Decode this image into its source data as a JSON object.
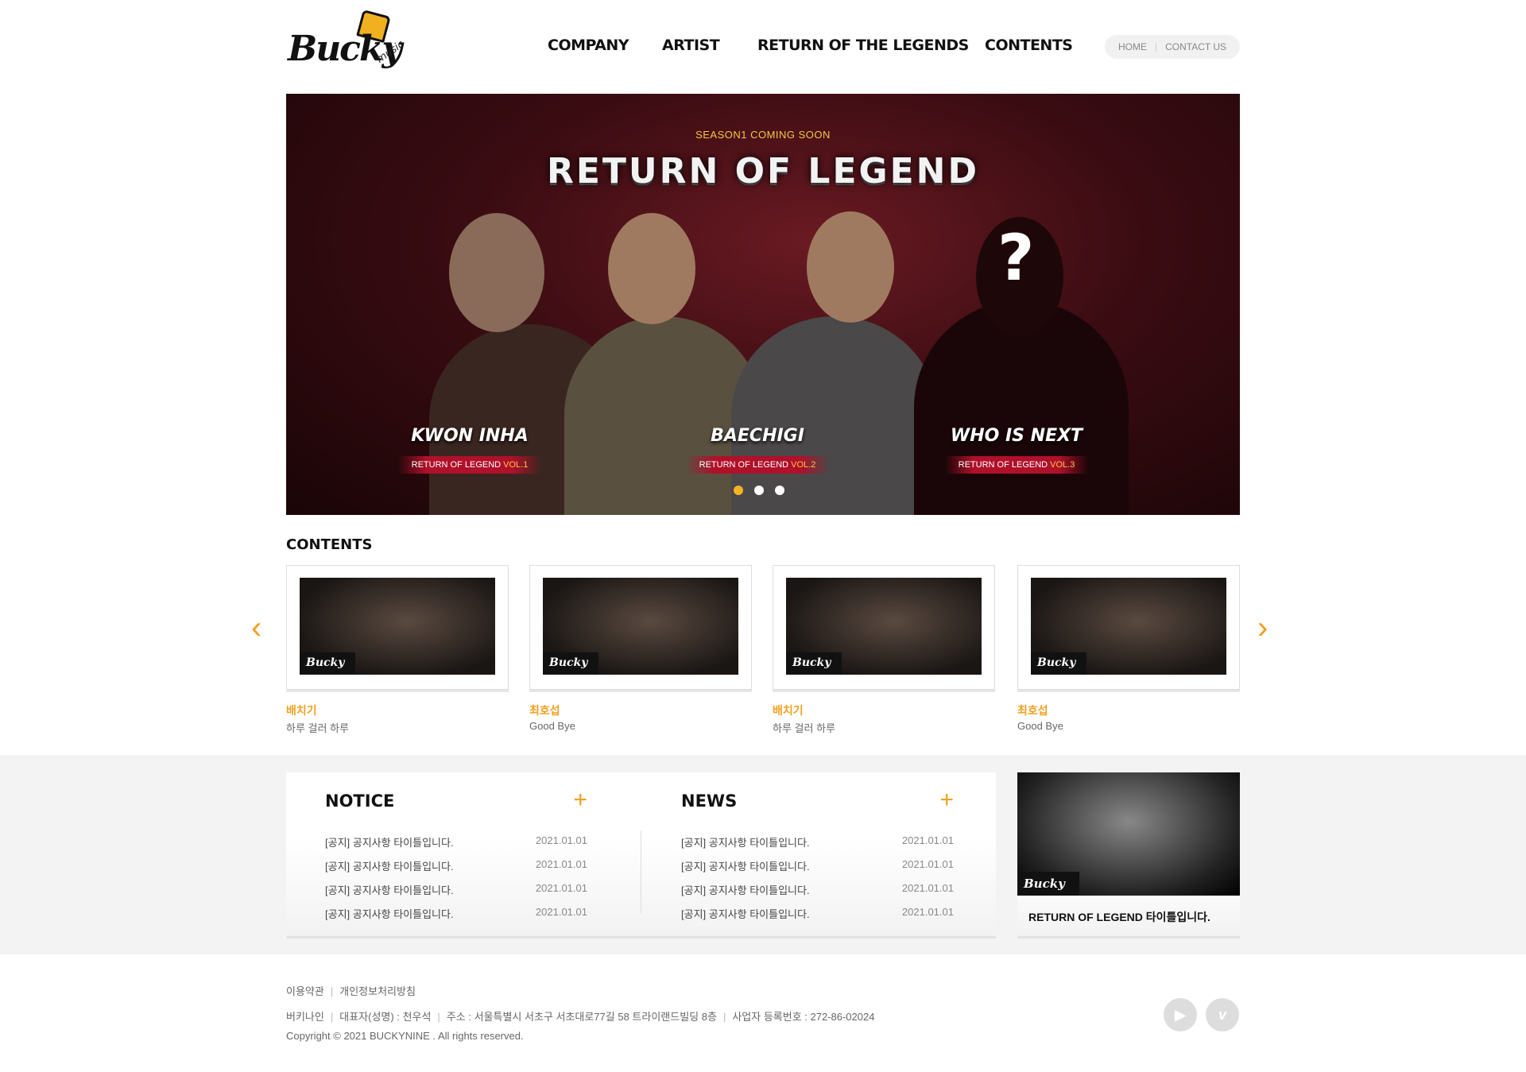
{
  "header": {
    "logo_text": "Bucky",
    "logo_sub": "music",
    "nav": [
      "COMPANY",
      "ARTIST",
      "RETURN OF THE LEGENDS",
      "CONTENTS"
    ],
    "util": {
      "home": "HOME",
      "contact": "CONTACT US"
    }
  },
  "banner": {
    "season": "SEASON1  COMING SOON",
    "title": "RETURN OF LEGEND",
    "artists": [
      {
        "name": "KWON INHA",
        "vol_prefix": "RETURN OF LEGEND ",
        "vol": "VOL.1"
      },
      {
        "name": "BAECHIGI",
        "vol_prefix": "RETURN OF LEGEND ",
        "vol": "VOL.2"
      },
      {
        "name": "WHO IS NEXT",
        "vol_prefix": "RETURN OF LEGEND ",
        "vol": "VOL.3"
      }
    ],
    "mystery": "?",
    "active_slide": 1,
    "slide_count": 3
  },
  "contents": {
    "title": "CONTENTS",
    "badge": "Bucky",
    "items": [
      {
        "artist": "배치기",
        "song": "하루 걸러 하루"
      },
      {
        "artist": "최호섭",
        "song": "Good Bye"
      },
      {
        "artist": "배치기",
        "song": "하루 걸러 하루"
      },
      {
        "artist": "최호섭",
        "song": "Good Bye"
      }
    ]
  },
  "notice": {
    "title": "NOTICE",
    "more": "+",
    "items": [
      {
        "t": "[공지] 공지사항 타이틀입니다.",
        "d": "2021.01.01"
      },
      {
        "t": "[공지] 공지사항 타이틀입니다.",
        "d": "2021.01.01"
      },
      {
        "t": "[공지] 공지사항 타이틀입니다.",
        "d": "2021.01.01"
      },
      {
        "t": "[공지] 공지사항 타이틀입니다.",
        "d": "2021.01.01"
      }
    ]
  },
  "news": {
    "title": "NEWS",
    "more": "+",
    "items": [
      {
        "t": "[공지] 공지사항 타이틀입니다.",
        "d": "2021.01.01"
      },
      {
        "t": "[공지] 공지사항 타이틀입니다.",
        "d": "2021.01.01"
      },
      {
        "t": "[공지] 공지사항 타이틀입니다.",
        "d": "2021.01.01"
      },
      {
        "t": "[공지] 공지사항 타이틀입니다.",
        "d": "2021.01.01"
      }
    ]
  },
  "featured": {
    "caption": "RETURN OF LEGEND 타이틀입니다.",
    "badge": "Bucky"
  },
  "footer": {
    "links": [
      "이용약관",
      "개인정보처리방침"
    ],
    "info": [
      "버키나인",
      "대표자(성명) : 천우석",
      "주소 : 서울특별시 서초구 서초대로77길 58 트라이랜드빌딩 8층",
      "사업자 등록번호 : 272-86-02024"
    ],
    "copyright": "Copyright © 2021 BUCKYNINE . All rights reserved.",
    "sns": [
      "youtube-icon",
      "vimeo-icon"
    ]
  },
  "colors": {
    "accent": "#f0a020",
    "banner_red": "#b0102a"
  }
}
